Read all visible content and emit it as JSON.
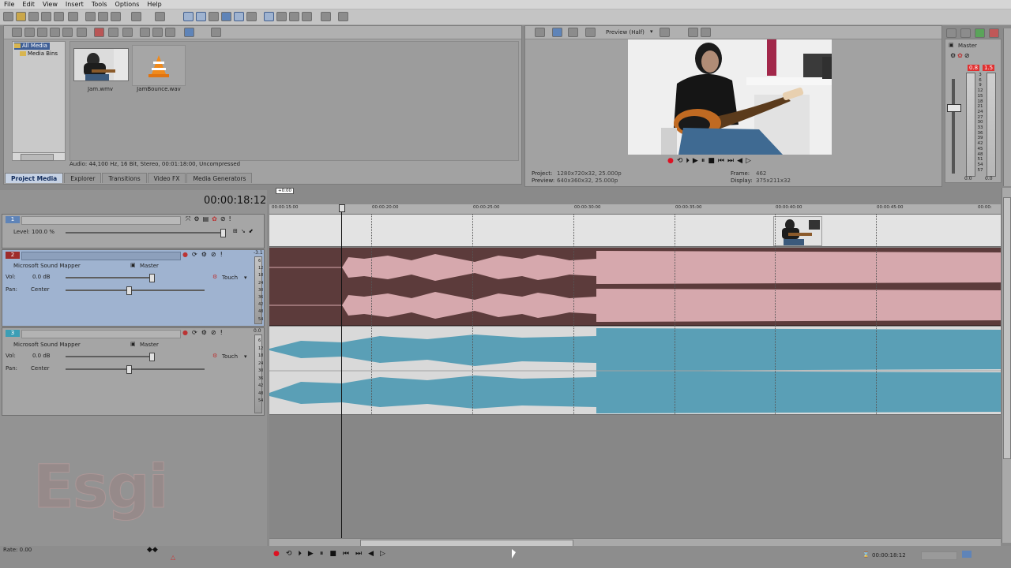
{
  "menu": [
    "File",
    "Edit",
    "View",
    "Insert",
    "Tools",
    "Options",
    "Help"
  ],
  "media_tree": [
    {
      "label": "All Media",
      "selected": true
    },
    {
      "label": "Media Bins",
      "selected": false
    }
  ],
  "media_files": [
    {
      "name": "Jam.wmv",
      "type": "video-thumb"
    },
    {
      "name": "JamBounce.wav",
      "type": "vlc-icon"
    }
  ],
  "media_info": "Audio: 44,100 Hz, 16 Bit, Stereo, 00:01:18:00, Uncompressed",
  "tabs": [
    {
      "label": "Project Media",
      "active": true
    },
    {
      "label": "Explorer",
      "active": false
    },
    {
      "label": "Transitions",
      "active": false
    },
    {
      "label": "Video FX",
      "active": false
    },
    {
      "label": "Media Generators",
      "active": false
    }
  ],
  "preview": {
    "mode_label": "Preview (Half)",
    "project_label": "Project:",
    "project_value": "1280x720x32, 25.000p",
    "preview_label": "Preview:",
    "preview_value": "640x360x32, 25.000p",
    "frame_label": "Frame:",
    "frame_value": "462",
    "display_label": "Display:",
    "display_value": "375x211x32"
  },
  "master": {
    "title": "Master",
    "peak_left": "0.8",
    "peak_right": "1.5",
    "scale": [
      "3",
      "6",
      "9",
      "12",
      "15",
      "18",
      "21",
      "24",
      "27",
      "30",
      "33",
      "36",
      "39",
      "42",
      "45",
      "48",
      "51",
      "54",
      "57"
    ],
    "bottom_left": "0.0",
    "bottom_right": "0.0"
  },
  "timecode": "00:00:18:12",
  "region_label": "+0:00",
  "ruler": [
    "00:00:15:00",
    "00:00:20:00",
    "00:00:25:00",
    "00:00:30:00",
    "00:00:35:00",
    "00:00:40:00",
    "00:00:45:00",
    "00:00:"
  ],
  "tracks": [
    {
      "number": "1",
      "kind": "video",
      "level_label": "Level: 100.0 %"
    },
    {
      "number": "2",
      "kind": "audio",
      "selected": true,
      "device": "Microsoft Sound Mapper",
      "bus": "Master",
      "vol_label": "Vol:",
      "vol_value": "0.0 dB",
      "pan_label": "Pan:",
      "pan_value": "Center",
      "mode": "Touch",
      "meter_top": "-3.1"
    },
    {
      "number": "3",
      "kind": "audio",
      "selected": false,
      "device": "Microsoft Sound Mapper",
      "bus": "Master",
      "vol_label": "Vol:",
      "vol_value": "0.0 dB",
      "pan_label": "Pan:",
      "pan_value": "Center",
      "mode": "Touch",
      "meter_top": "0.0"
    }
  ],
  "meter_scale": [
    "6",
    "12",
    "18",
    "24",
    "30",
    "36",
    "42",
    "48",
    "54"
  ],
  "rate": "Rate: 0.00",
  "status_timecode": "00:00:18:12",
  "watermark": "Esgi",
  "colors": {
    "track2_bg": "#5c3b3b",
    "track2_wave": "#d6a8ad",
    "track3_bg": "#d9d9d9",
    "track3_wave": "#5a9fb6",
    "selected_header": "#9fb3d0",
    "accent_red": "#e03030"
  }
}
